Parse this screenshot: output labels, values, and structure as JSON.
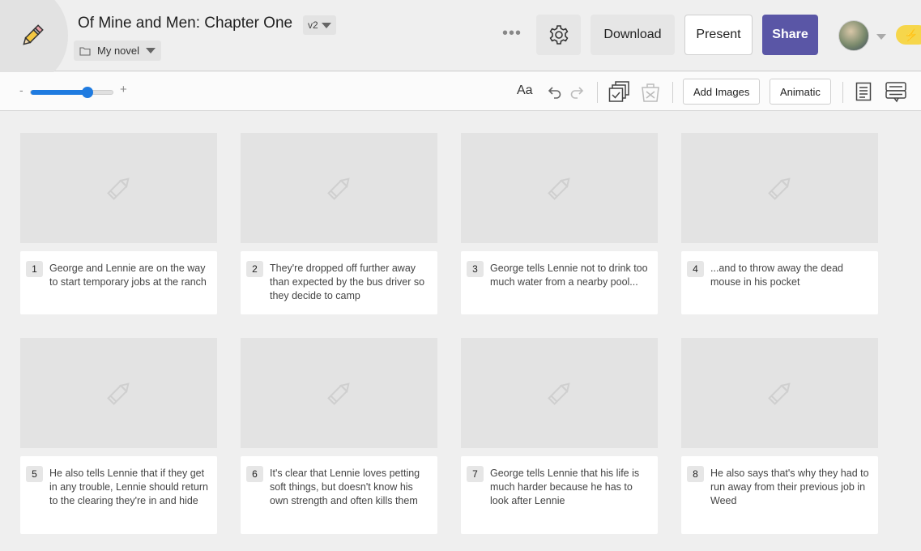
{
  "header": {
    "title": "Of Mine and Men: Chapter One",
    "version": "v2",
    "folder": "My novel",
    "more_label": "•••",
    "download_label": "Download",
    "present_label": "Present",
    "share_label": "Share",
    "bolt_glyph": "⚡"
  },
  "toolbar": {
    "zoom_minus": "-",
    "zoom_plus": "+",
    "zoom_level": 0.68,
    "font_label": "Aa",
    "add_images_label": "Add Images",
    "animatic_label": "Animatic"
  },
  "colors": {
    "accent": "#5a56a6",
    "slider": "#1f7be0"
  },
  "cells": [
    {
      "num": "1",
      "text": "George and Lennie are on the way to start temporary jobs at the ranch"
    },
    {
      "num": "2",
      "text": "They're dropped off further away than expected by the bus driver so they decide to camp"
    },
    {
      "num": "3",
      "text": "George tells Lennie not to drink too much water from a nearby pool..."
    },
    {
      "num": "4",
      "text": "...and to throw away the dead mouse in his pocket"
    },
    {
      "num": "5",
      "text": "He also tells Lennie that if they get in any trouble, Lennie should return to the clearing they're in and hide"
    },
    {
      "num": "6",
      "text": "It's clear that Lennie loves petting soft things, but doesn't know his own strength and often kills them"
    },
    {
      "num": "7",
      "text": "George tells Lennie that his life is much harder because he has to look after Lennie"
    },
    {
      "num": "8",
      "text": "He also says that's why they had to run away from their previous job in Weed"
    }
  ]
}
